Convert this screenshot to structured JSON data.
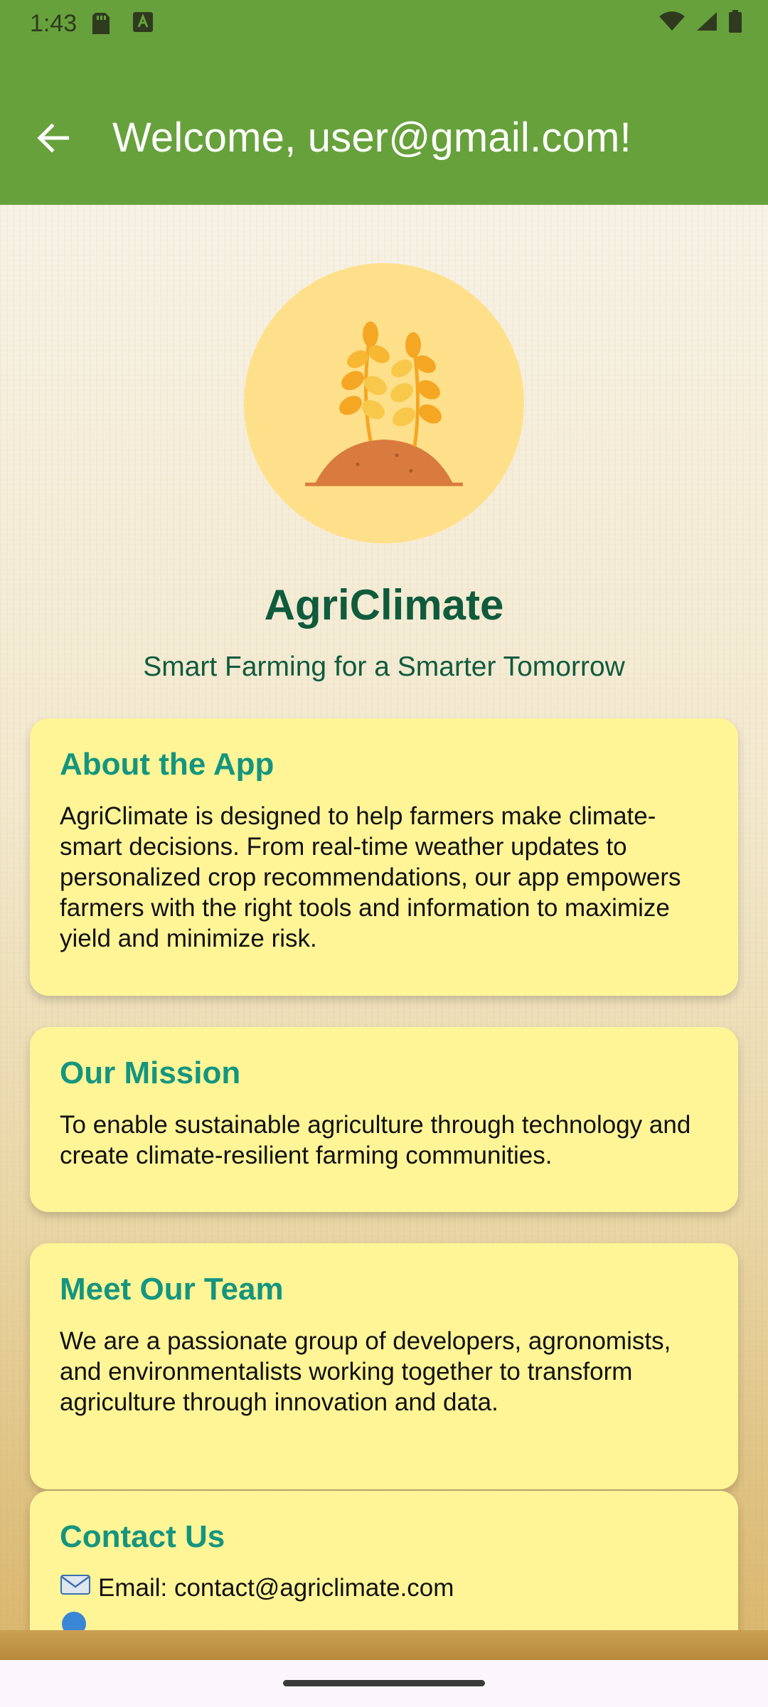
{
  "status": {
    "time": "1:43"
  },
  "appbar": {
    "title": "Welcome, user@gmail.com!"
  },
  "hero": {
    "app_name": "AgriClimate",
    "tagline": "Smart Farming for a Smarter Tomorrow"
  },
  "cards": [
    {
      "title": "About the App",
      "body": "AgriClimate is designed to help farmers make climate-smart decisions. From real-time weather updates to personalized crop recommendations, our app empowers farmers with the right tools and information to maximize yield and minimize risk."
    },
    {
      "title": "Our Mission",
      "body": "To enable sustainable agriculture through technology and create climate-resilient farming communities."
    },
    {
      "title": "Meet Our Team",
      "body": "We are a passionate group of developers, agronomists, and environmentalists working together to transform agriculture through innovation and data."
    },
    {
      "title": "Contact Us",
      "email_line": "Email: contact@agriclimate.com"
    }
  ],
  "colors": {
    "appbar": "#67a13b",
    "card": "#fff596",
    "card_title": "#14957f",
    "app_name": "#0f5b3c",
    "logo_bg": "#ffe08a"
  },
  "icons": {
    "back": "arrow-left-icon",
    "logo": "wheat-sprouts-icon",
    "email": "envelope-icon"
  }
}
